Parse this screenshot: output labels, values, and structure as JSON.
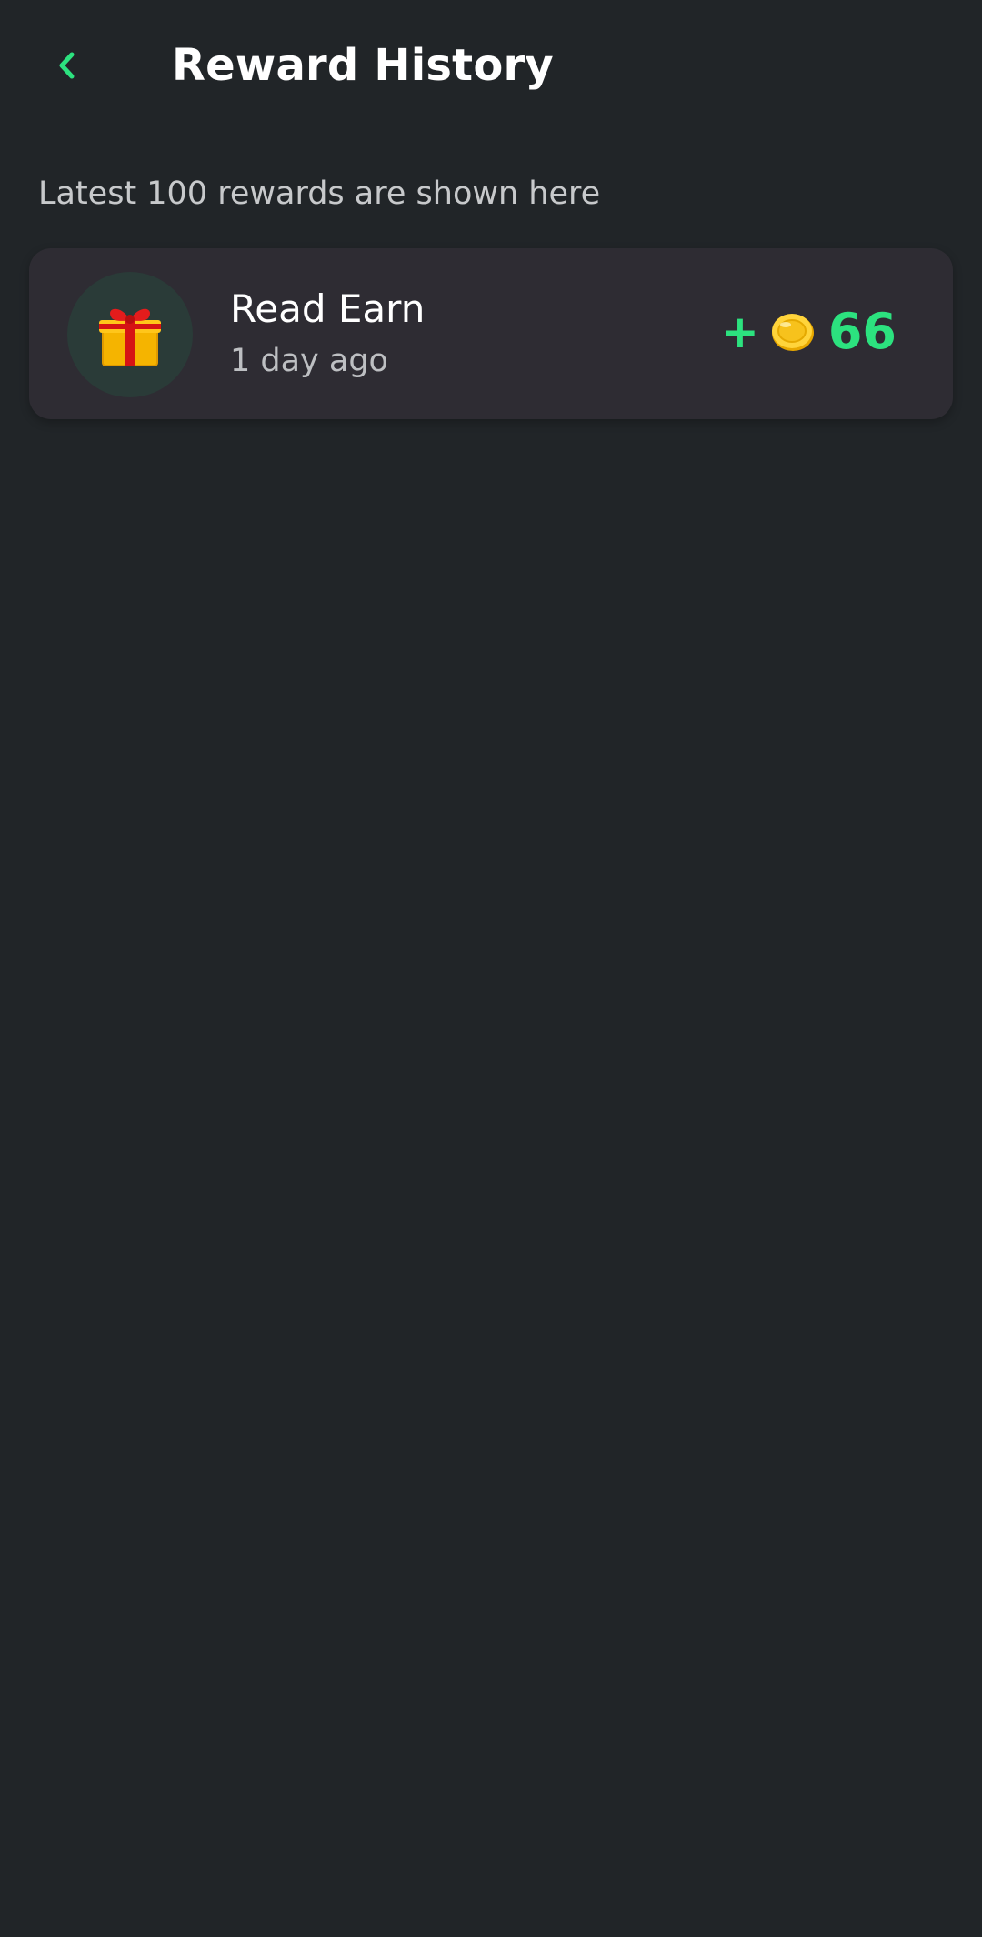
{
  "header": {
    "title": "Reward History",
    "back_icon": "chevron-left-icon"
  },
  "subtitle": "Latest 100 rewards are shown here",
  "rewards": [
    {
      "title": "Read Earn",
      "time": "1 day ago",
      "sign": "+",
      "amount": "66",
      "icon": "gift-icon",
      "currency_icon": "coin-icon"
    }
  ],
  "colors": {
    "background": "#212528",
    "card": "#2E2C33",
    "accent": "#2CE27F",
    "icon_circle": "#2A3B38"
  }
}
